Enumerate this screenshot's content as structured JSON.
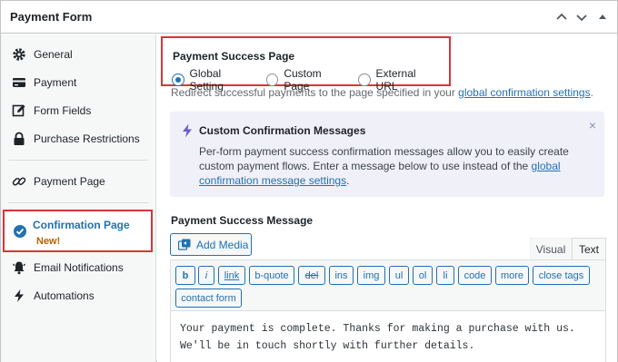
{
  "panel": {
    "title": "Payment Form",
    "header_icons": [
      "chevron-up-icon",
      "chevron-down-icon",
      "caret-up-icon"
    ]
  },
  "sidebar": {
    "items": [
      {
        "label": "General",
        "icon": "gear-icon"
      },
      {
        "label": "Payment",
        "icon": "credit-card-icon"
      },
      {
        "label": "Form Fields",
        "icon": "edit-icon"
      },
      {
        "label": "Purchase Restrictions",
        "icon": "lock-icon"
      },
      {
        "label": "Payment Page",
        "icon": "link-icon"
      },
      {
        "label": "Confirmation Page",
        "icon": "check-circle-icon",
        "badge": "New!",
        "active": true
      },
      {
        "label": "Email Notifications",
        "icon": "bell-icon"
      },
      {
        "label": "Automations",
        "icon": "bolt-icon"
      }
    ]
  },
  "success_page": {
    "title": "Payment Success Page",
    "options": [
      "Global Setting",
      "Custom Page",
      "External URL"
    ],
    "selected": "Global Setting",
    "help_prefix": "Redirect successful payments to the page specified in your ",
    "help_link": "global confirmation settings",
    "help_suffix": "."
  },
  "notice": {
    "title": "Custom Confirmation Messages",
    "text": "Per-form payment success confirmation messages allow you to easily create custom payment flows. Enter a message below to use instead of the ",
    "link": "global confirmation message settings",
    "suffix": ".",
    "close": "×"
  },
  "message": {
    "title": "Payment Success Message",
    "add_media": "Add Media",
    "tabs": [
      "Visual",
      "Text"
    ],
    "active_tab": "Text",
    "quicktags": [
      "b",
      "i",
      "link",
      "b-quote",
      "del",
      "ins",
      "img",
      "ul",
      "ol",
      "li",
      "code",
      "more",
      "close tags",
      "contact form"
    ],
    "content": "Your payment is complete. Thanks for making a purchase with us. We'll be in touch shortly with further details."
  },
  "colors": {
    "accent": "#2271b1",
    "highlight_border": "#d63638",
    "badge": "#b26200",
    "notice_bg": "#f0f0f9",
    "notice_icon": "#6b5bd2"
  }
}
